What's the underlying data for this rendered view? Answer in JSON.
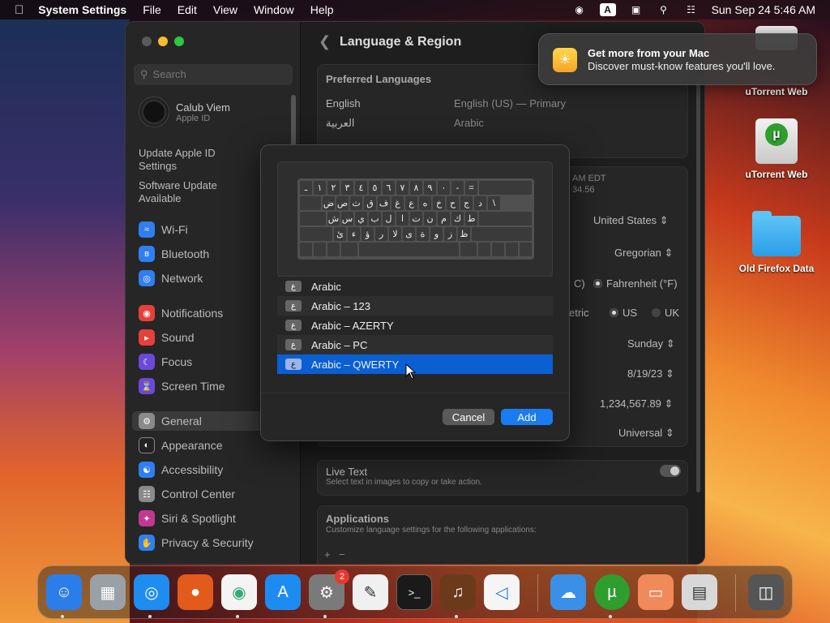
{
  "menubar": {
    "app_name": "System Settings",
    "menus": [
      "File",
      "Edit",
      "View",
      "Window",
      "Help"
    ],
    "input_source": "A",
    "datetime": "Sun Sep 24  5:46 AM"
  },
  "sidebar": {
    "search_placeholder": "Search",
    "user_name": "Calub Viem",
    "user_sub": "Apple ID",
    "update_apple_id": "Update Apple ID Settings",
    "software_update": "Software Update Available",
    "items": [
      {
        "label": "Wi-Fi",
        "icon": "wifi-icon",
        "color": "#2f7ff0"
      },
      {
        "label": "Bluetooth",
        "icon": "bluetooth-icon",
        "color": "#2f7ff0"
      },
      {
        "label": "Network",
        "icon": "globe-icon",
        "color": "#2f7ff0"
      },
      {
        "label": "Notifications",
        "icon": "bell-icon",
        "color": "#e5403a"
      },
      {
        "label": "Sound",
        "icon": "speaker-icon",
        "color": "#e5403a"
      },
      {
        "label": "Focus",
        "icon": "moon-icon",
        "color": "#6a4ad8"
      },
      {
        "label": "Screen Time",
        "icon": "hourglass-icon",
        "color": "#6a4ad8"
      },
      {
        "label": "General",
        "icon": "gear-icon",
        "color": "#8a8a8a"
      },
      {
        "label": "Appearance",
        "icon": "appearance-icon",
        "color": "#222222"
      },
      {
        "label": "Accessibility",
        "icon": "accessibility-icon",
        "color": "#2f7ff0"
      },
      {
        "label": "Control Center",
        "icon": "control-center-icon",
        "color": "#8a8a8a"
      },
      {
        "label": "Siri & Spotlight",
        "icon": "siri-icon",
        "color": "#c2388f"
      },
      {
        "label": "Privacy & Security",
        "icon": "hand-icon",
        "color": "#2f7ff0"
      }
    ]
  },
  "content": {
    "title": "Language & Region",
    "preferred_languages_heading": "Preferred Languages",
    "languages": [
      {
        "name": "English",
        "detail": "English (US) — Primary"
      },
      {
        "name": "العربية",
        "detail": "Arabic"
      }
    ],
    "time_fragment_1": "AM EDT",
    "time_fragment_2": "34.56",
    "region_value": "United States",
    "calendar_value": "Gregorian",
    "temp_celsius_fragment": "C)",
    "temp_fahrenheit": "Fahrenheit (°F)",
    "measure_metric_fragment": "etric",
    "measure_us": "US",
    "measure_uk": "UK",
    "first_day_value": "Sunday",
    "date_format_value": "8/19/23",
    "number_format_value": "1,234,567.89",
    "list_sort_value": "Universal",
    "live_text_label": "Live Text",
    "live_text_desc": "Select text in images to copy or take action.",
    "applications_heading": "Applications",
    "applications_desc": "Customize language settings for the following applications:",
    "add_symbol": "+",
    "minus_symbol": "−"
  },
  "dialog": {
    "keyboard_rows": [
      [
        "ـ",
        "١",
        "٢",
        "٣",
        "٤",
        "٥",
        "٦",
        "٧",
        "٨",
        "٩",
        "٠",
        "-",
        "="
      ],
      [
        "ض",
        "ص",
        "ث",
        "ق",
        "ف",
        "غ",
        "ع",
        "ه",
        "خ",
        "ح",
        "ج",
        "د",
        "\\"
      ],
      [
        "ش",
        "س",
        "ي",
        "ب",
        "ل",
        "ا",
        "ت",
        "ن",
        "م",
        "ك",
        "ط"
      ],
      [
        "ئ",
        "ء",
        "ؤ",
        "ر",
        "لا",
        "ى",
        "ة",
        "و",
        "ز",
        "ظ"
      ]
    ],
    "layouts": [
      {
        "badge": "ع",
        "label": "Arabic"
      },
      {
        "badge": "ع",
        "label": "Arabic – 123"
      },
      {
        "badge": "ع",
        "label": "Arabic – AZERTY"
      },
      {
        "badge": "ع",
        "label": "Arabic – PC"
      },
      {
        "badge": "ع",
        "label": "Arabic – QWERTY"
      }
    ],
    "selected_index": 4,
    "cancel_label": "Cancel",
    "add_label": "Add"
  },
  "notification": {
    "title": "Get more from your Mac",
    "body": "Discover must-know features you'll love."
  },
  "desktop": {
    "items": [
      "uTorrent Web",
      "uTorrent Web",
      "Old Firefox Data"
    ]
  },
  "dock": {
    "apps": [
      {
        "name": "finder-icon",
        "bg": "#2b7de9",
        "glyph": "☺"
      },
      {
        "name": "launchpad-icon",
        "bg": "#9aa0a8",
        "glyph": "▦"
      },
      {
        "name": "safari-icon",
        "bg": "#1f8cf0",
        "glyph": "◎"
      },
      {
        "name": "firefox-icon",
        "bg": "#e25a1c",
        "glyph": "●"
      },
      {
        "name": "chrome-icon",
        "bg": "#f4f4f4",
        "glyph": "◉"
      },
      {
        "name": "app-store-icon",
        "bg": "#1d8cf2",
        "glyph": "A"
      },
      {
        "name": "system-settings-icon",
        "bg": "#7a7a7a",
        "glyph": "⚙"
      },
      {
        "name": "textedit-icon",
        "bg": "#f0f0f0",
        "glyph": "✎"
      },
      {
        "name": "terminal-icon",
        "bg": "#1a1a1a",
        "glyph": ">_"
      },
      {
        "name": "garageband-icon",
        "bg": "#6b3a1a",
        "glyph": "♫"
      },
      {
        "name": "vscode-icon",
        "bg": "#f5f5f5",
        "glyph": "◁"
      },
      {
        "name": "weather-icon",
        "bg": "#3a8fe6",
        "glyph": "☁"
      },
      {
        "name": "utorrent-icon",
        "bg": "#2e9e2e",
        "glyph": "µ"
      },
      {
        "name": "screen-sharing-icon",
        "bg": "#f08a5a",
        "glyph": "▭"
      },
      {
        "name": "calculator-icon",
        "bg": "#d8d8d8",
        "glyph": "▤"
      },
      {
        "name": "trash-icon",
        "bg": "#555555",
        "glyph": "🗑"
      }
    ],
    "settings_badge": "2"
  }
}
